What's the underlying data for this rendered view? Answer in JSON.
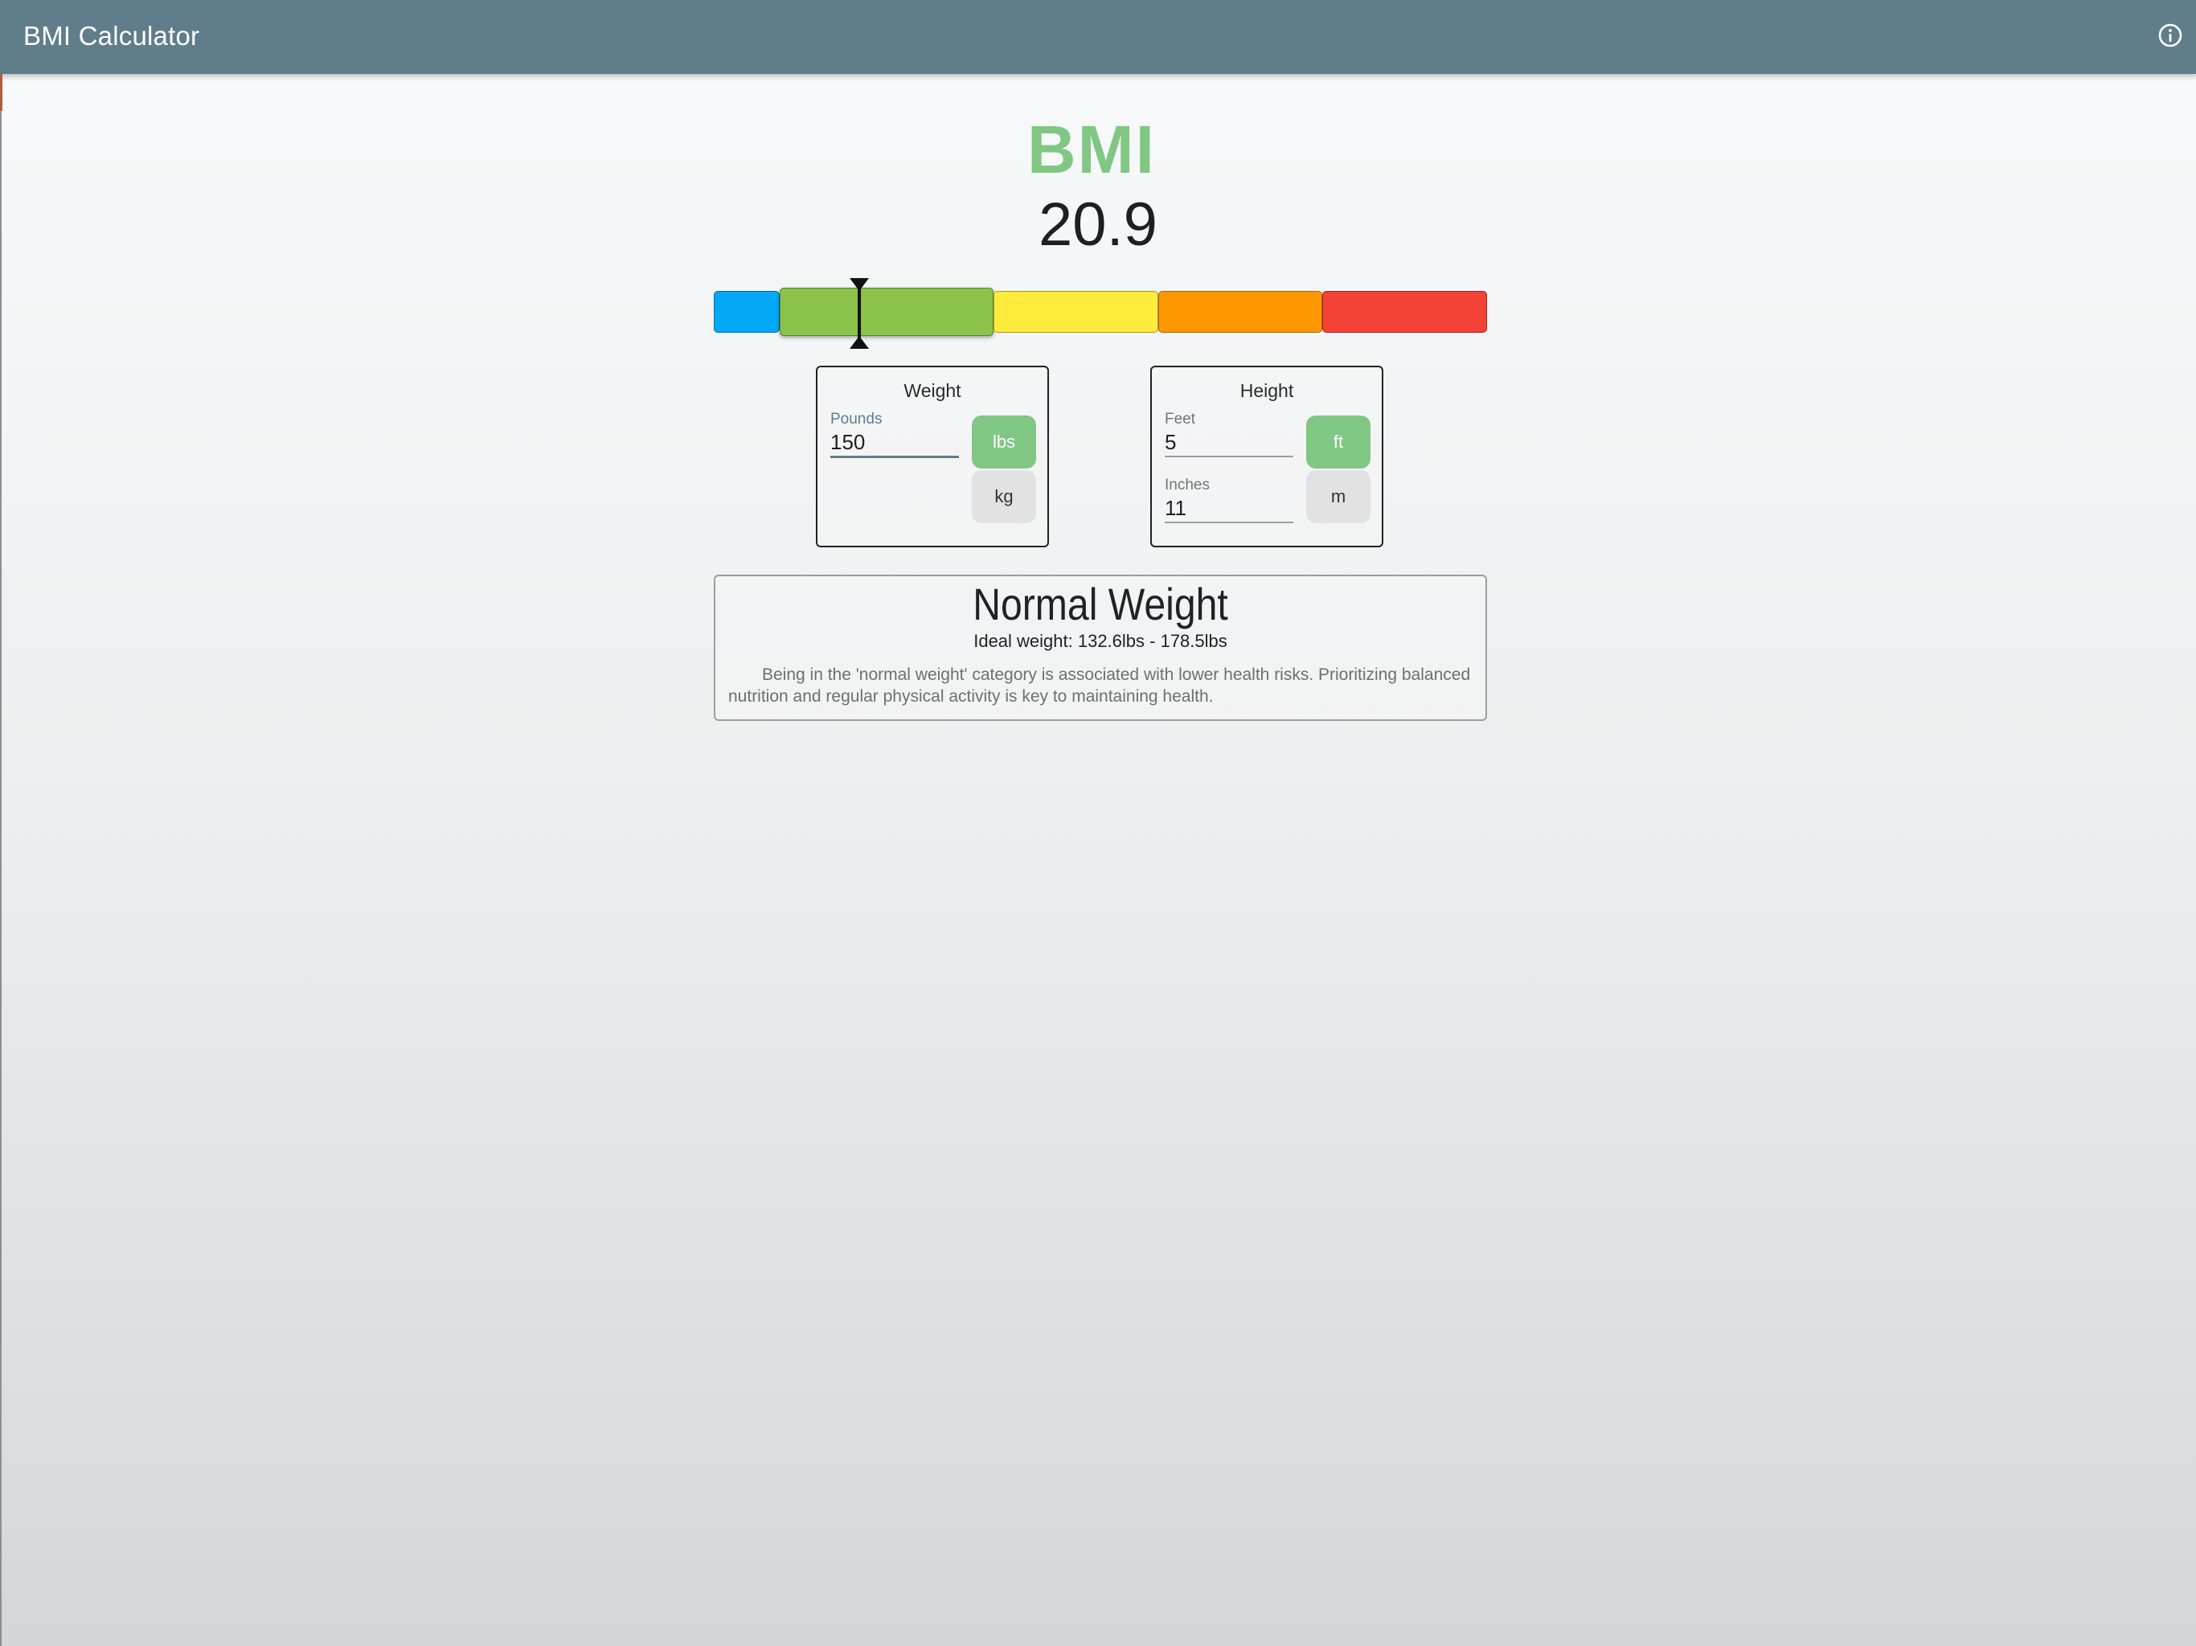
{
  "app": {
    "title": "BMI Calculator",
    "info_icon": "info-circle-icon"
  },
  "bmi": {
    "label": "BMI",
    "value": "20.9",
    "label_color": "#81c784"
  },
  "scale": {
    "segments": [
      {
        "category": "underweight",
        "color": "#03a9f4"
      },
      {
        "category": "normal",
        "color": "#8bc34a",
        "active": true
      },
      {
        "category": "overweight",
        "color": "#ffeb3b"
      },
      {
        "category": "obese",
        "color": "#ff9800"
      },
      {
        "category": "extremely-obese",
        "color": "#f44336"
      }
    ],
    "indicator_icon": "hourglass-marker-icon"
  },
  "weight": {
    "title": "Weight",
    "field_label": "Pounds",
    "value": "150",
    "units": [
      {
        "label": "lbs",
        "selected": true
      },
      {
        "label": "kg",
        "selected": false
      }
    ]
  },
  "height": {
    "title": "Height",
    "feet_label": "Feet",
    "feet_value": "5",
    "inches_label": "Inches",
    "inches_value": "11",
    "units": [
      {
        "label": "ft",
        "selected": true
      },
      {
        "label": "m",
        "selected": false
      }
    ]
  },
  "result": {
    "category": "Normal Weight",
    "ideal": "Ideal weight: 132.6lbs - 178.5lbs",
    "description": "Being in the 'normal weight' category is associated with lower health risks. Prioritizing balanced nutrition and regular physical activity is key to maintaining health."
  },
  "colors": {
    "appbar": "#607d8b",
    "accent_green": "#81c784"
  }
}
